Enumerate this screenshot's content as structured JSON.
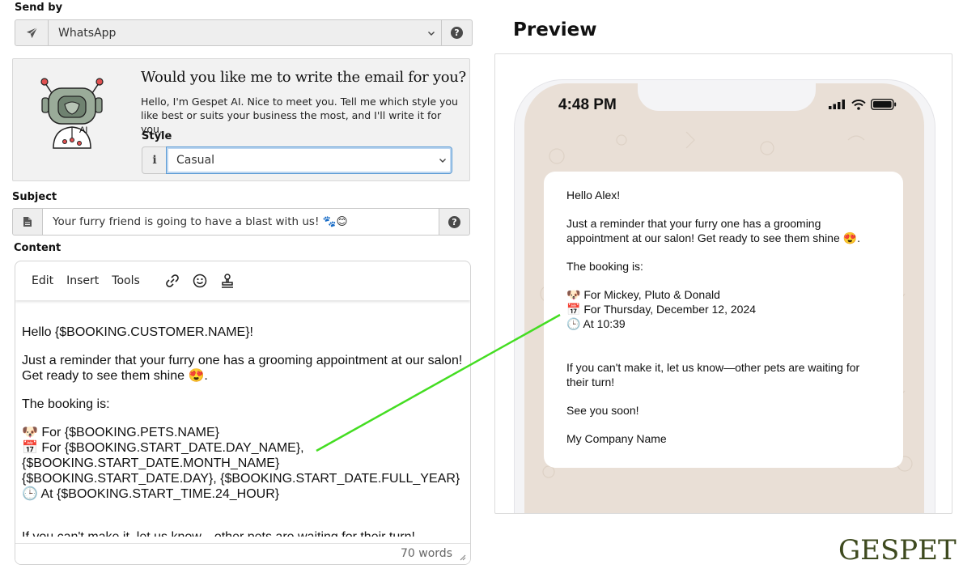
{
  "send_by": {
    "label": "Send by",
    "value": "WhatsApp",
    "icon": "paper-plane-icon"
  },
  "ai": {
    "title": "Would you like me to write the email for you?",
    "description": "Hello, I'm Gespet AI. Nice to meet you. Tell me which style you like best or suits your business the most, and I'll write it for you.",
    "robot_badge": "AI",
    "style_label": "Style",
    "style_value": "Casual",
    "style_icon": "info-icon"
  },
  "subject": {
    "label": "Subject",
    "value": "Your furry friend is going to have a blast with us! 🐾😊",
    "icon": "document-icon"
  },
  "content": {
    "label": "Content",
    "menus": [
      "Edit",
      "Insert",
      "Tools"
    ],
    "body": {
      "greeting": "Hello {$BOOKING.CUSTOMER.NAME}!",
      "reminder": "Just a reminder that your furry one has a grooming appointment at our salon! Get ready to see them shine 😍.",
      "booking_intro": "The booking is:",
      "line_pets": "🐶 For {$BOOKING.PETS.NAME}",
      "line_date": "📅 For {$BOOKING.START_DATE.DAY_NAME}, {$BOOKING.START_DATE.MONTH_NAME} {$BOOKING.START_DATE.DAY}, {$BOOKING.START_DATE.FULL_YEAR}",
      "line_time": "🕒 At {$BOOKING.START_TIME.24_HOUR}",
      "cut_line": "If you can't make it, let us know—other pets are waiting for their turn!"
    },
    "word_count": "70 words"
  },
  "preview": {
    "title": "Preview",
    "status_time": "4:48 PM",
    "message": {
      "greeting": "Hello Alex!",
      "reminder": "Just a reminder that your furry one has a grooming appointment at our salon! Get ready to see them shine 😍.",
      "booking_intro": "The booking is:",
      "line_pets": "🐶 For Mickey, Pluto & Donald",
      "line_date": "📅 For Thursday, December 12, 2024",
      "line_time": "🕒 At 10:39",
      "cant_make": "If you can't make it, let us know—other pets are waiting for their turn!",
      "see_you": "See you soon!",
      "signature": "My Company Name"
    }
  },
  "brand": {
    "logo_text": "GESPET",
    "accent": "#44dd22"
  }
}
